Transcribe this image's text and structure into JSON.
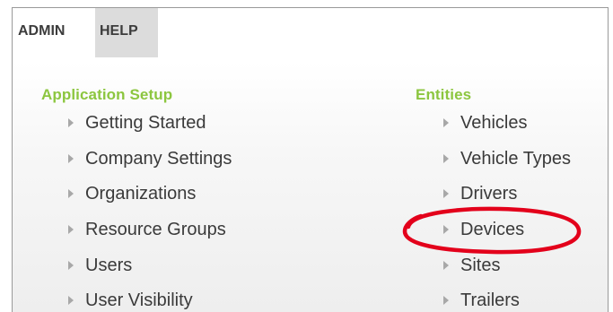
{
  "tabs": {
    "admin": "ADMIN",
    "help": "HELP"
  },
  "application_setup": {
    "title": "Application Setup",
    "items": [
      "Getting Started",
      "Company Settings",
      "Organizations",
      "Resource Groups",
      "Users",
      "User Visibility"
    ]
  },
  "entities": {
    "title": "Entities",
    "items": [
      "Vehicles",
      "Vehicle Types",
      "Drivers",
      "Devices",
      "Sites",
      "Trailers"
    ]
  },
  "colors": {
    "section_title": "#8cc63f",
    "highlight_ring": "#e3001b",
    "help_tab_bg": "#dcdcdc",
    "arrow": "#a8a8a8"
  },
  "annotation": {
    "highlighted_item": "Devices"
  }
}
